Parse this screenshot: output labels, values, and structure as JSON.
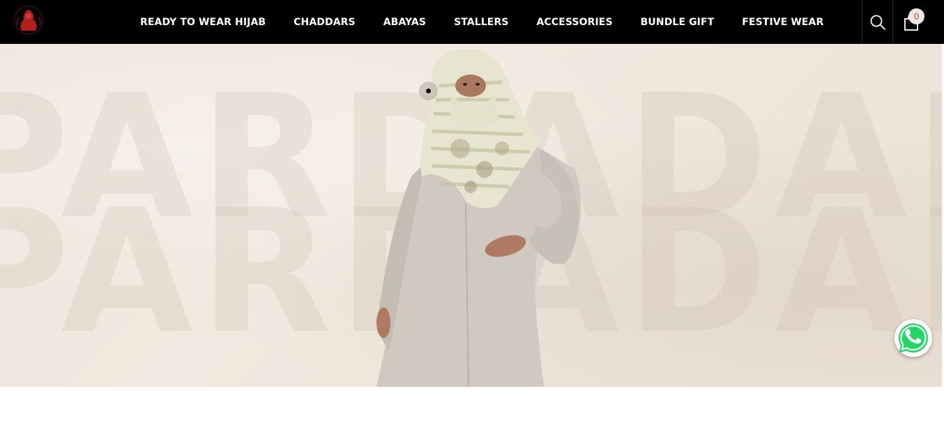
{
  "brand": {
    "logo_icon": "pardadari-logo-icon",
    "colors": {
      "header_bg": "#000000",
      "nav_text": "#ffffff",
      "hero_bg": "#efe6dc",
      "cart_badge_bg": "#f4e6e1",
      "cart_badge_text": "#b04a39",
      "whatsapp_green": "#25d366"
    }
  },
  "nav": {
    "items": [
      {
        "label": "READY TO WEAR HIJAB"
      },
      {
        "label": "CHADDARS"
      },
      {
        "label": "ABAYAS"
      },
      {
        "label": "STALLERS"
      },
      {
        "label": "ACCESSORIES"
      },
      {
        "label": "BUNDLE GIFT"
      },
      {
        "label": "FESTIVE WEAR"
      }
    ]
  },
  "header_icons": {
    "search_icon": "search-icon",
    "cart_icon": "shopping-bag-icon",
    "cart_count": "0"
  },
  "hero": {
    "background_word": "PARDADARI",
    "slider": {
      "current_slide": 1,
      "total_slides": 1
    }
  },
  "floating": {
    "whatsapp_icon": "whatsapp-icon"
  }
}
